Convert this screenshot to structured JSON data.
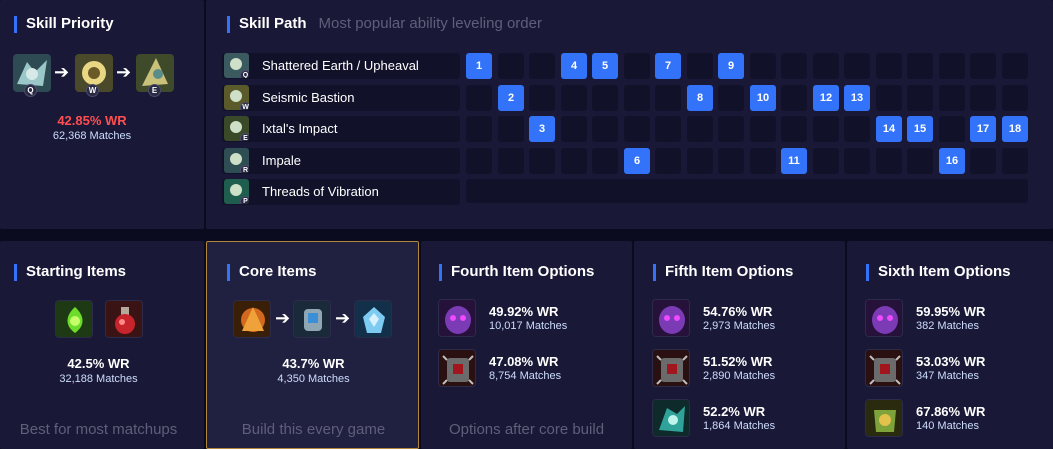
{
  "skill_priority": {
    "title": "Skill Priority",
    "keys": [
      "Q",
      "W",
      "E"
    ],
    "win_rate": "42.85% WR",
    "matches": "62,368 Matches"
  },
  "skill_path": {
    "title": "Skill Path",
    "subtitle": "Most popular ability leveling order",
    "rows": [
      {
        "key": "Q",
        "name": "Shattered Earth / Upheaval",
        "levels": [
          1,
          4,
          5,
          7,
          9
        ]
      },
      {
        "key": "W",
        "name": "Seismic Bastion",
        "levels": [
          2,
          8,
          10,
          12,
          13
        ]
      },
      {
        "key": "E",
        "name": "Ixtal's Impact",
        "levels": [
          3,
          14,
          15,
          17,
          18
        ]
      },
      {
        "key": "R",
        "name": "Impale",
        "levels": [
          6,
          11,
          16
        ]
      },
      {
        "key": "P",
        "name": "Threads of Vibration",
        "levels": []
      }
    ]
  },
  "starting_items": {
    "title": "Starting Items",
    "win_rate": "42.5% WR",
    "matches": "32,188 Matches",
    "footer": "Best for most matchups"
  },
  "core_items": {
    "title": "Core Items",
    "win_rate": "43.7% WR",
    "matches": "4,350 Matches",
    "footer": "Build this every game"
  },
  "fourth_items": {
    "title": "Fourth Item Options",
    "footer": "Options after core build",
    "options": [
      {
        "win_rate": "49.92% WR",
        "matches": "10,017 Matches"
      },
      {
        "win_rate": "47.08% WR",
        "matches": "8,754 Matches"
      }
    ]
  },
  "fifth_items": {
    "title": "Fifth Item Options",
    "options": [
      {
        "win_rate": "54.76% WR",
        "matches": "2,973 Matches"
      },
      {
        "win_rate": "51.52% WR",
        "matches": "2,890 Matches"
      },
      {
        "win_rate": "52.2% WR",
        "matches": "1,864 Matches"
      }
    ]
  },
  "sixth_items": {
    "title": "Sixth Item Options",
    "options": [
      {
        "win_rate": "59.95% WR",
        "matches": "382 Matches"
      },
      {
        "win_rate": "53.03% WR",
        "matches": "347 Matches"
      },
      {
        "win_rate": "67.86% WR",
        "matches": "140 Matches"
      }
    ]
  },
  "colors": {
    "accent": "#3273fa",
    "panel": "#191937",
    "low_wr": "#ff4e50",
    "core_border": "#b2863b"
  },
  "icons": [
    "ability-q-icon",
    "ability-w-icon",
    "ability-e-icon",
    "ability-r-icon",
    "passive-icon",
    "item-icon",
    "arrow-right-icon"
  ]
}
